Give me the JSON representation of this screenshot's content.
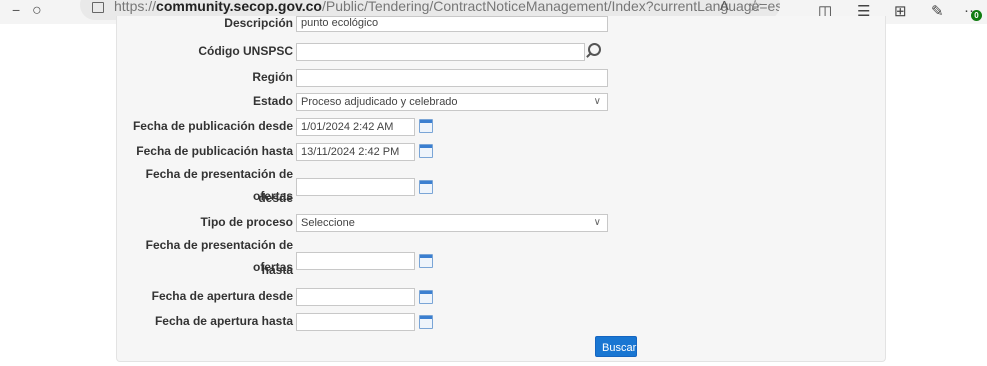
{
  "browser": {
    "url_prefix": "https://",
    "url_host": "community.secop.gov.co",
    "url_path": "/Public/Tendering/ContractNoticeManagement/Index?currentLanguage=es-CO&Page=logi...",
    "badge": "0"
  },
  "form": {
    "descripcion_label": "Descripción",
    "descripcion_value": "punto ecológico",
    "unspsc_label": "Código UNSPSC",
    "unspsc_value": "",
    "region_label": "Región",
    "region_value": "",
    "estado_label": "Estado",
    "estado_value": "Proceso adjudicado y celebrado",
    "pub_desde_label": "Fecha de publicación desde",
    "pub_desde_value": "1/01/2024 2:42 AM",
    "pub_hasta_label": "Fecha de publicación hasta",
    "pub_hasta_value": "13/11/2024 2:42 PM",
    "pres_desde_label_1": "Fecha de presentación de ofertas",
    "pres_desde_label_2": "desde",
    "pres_desde_value": "",
    "tipo_label": "Tipo de proceso",
    "tipo_value": "Seleccione",
    "pres_hasta_label_1": "Fecha de presentación de ofertas",
    "pres_hasta_label_2": "hasta",
    "pres_hasta_value": "",
    "apertura_desde_label": "Fecha de apertura desde",
    "apertura_desde_value": "",
    "apertura_hasta_label": "Fecha de apertura hasta",
    "apertura_hasta_value": "",
    "buscar_label": "Buscar"
  },
  "icons": {
    "calendar": "calendar-icon",
    "search": "search-icon",
    "chevron": "chevron-down-icon"
  },
  "colors": {
    "primary_button": "#1976d2",
    "panel_bg": "#f6f6f6"
  }
}
